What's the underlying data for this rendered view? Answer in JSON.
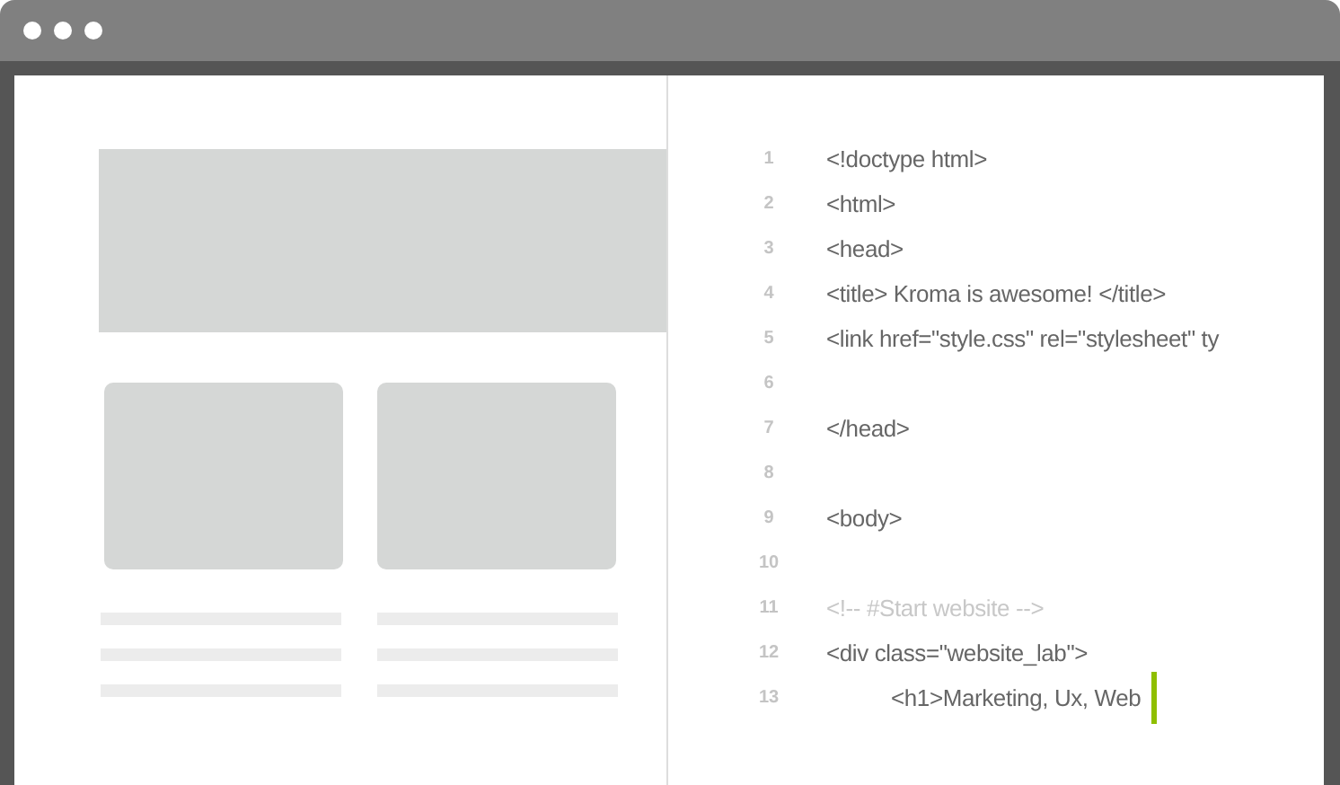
{
  "code_editor": {
    "lines": [
      {
        "number": "1",
        "kind": "code",
        "text": "<!doctype html>"
      },
      {
        "number": "2",
        "kind": "code",
        "text": "<html>"
      },
      {
        "number": "3",
        "kind": "code",
        "text": "<head>"
      },
      {
        "number": "4",
        "kind": "code",
        "text": "<title> Kroma is awesome! </title>"
      },
      {
        "number": "5",
        "kind": "code",
        "text": "<link href=\"style.css\" rel=\"stylesheet\" ty"
      },
      {
        "number": "6",
        "kind": "blank"
      },
      {
        "number": "7",
        "kind": "code",
        "text": "</head>"
      },
      {
        "number": "8",
        "kind": "blank"
      },
      {
        "number": "9",
        "kind": "code",
        "text": "<body>"
      },
      {
        "number": "10",
        "kind": "blank"
      },
      {
        "number": "11",
        "kind": "comment",
        "text": "<!-- #Start website -->"
      },
      {
        "number": "12",
        "kind": "code",
        "text": "<div class=\"website_lab\">",
        "children": [
          {
            "number": "13",
            "kind": "code",
            "text": "<h1>Marketing, Ux, Web",
            "cursor": true
          }
        ]
      }
    ]
  }
}
